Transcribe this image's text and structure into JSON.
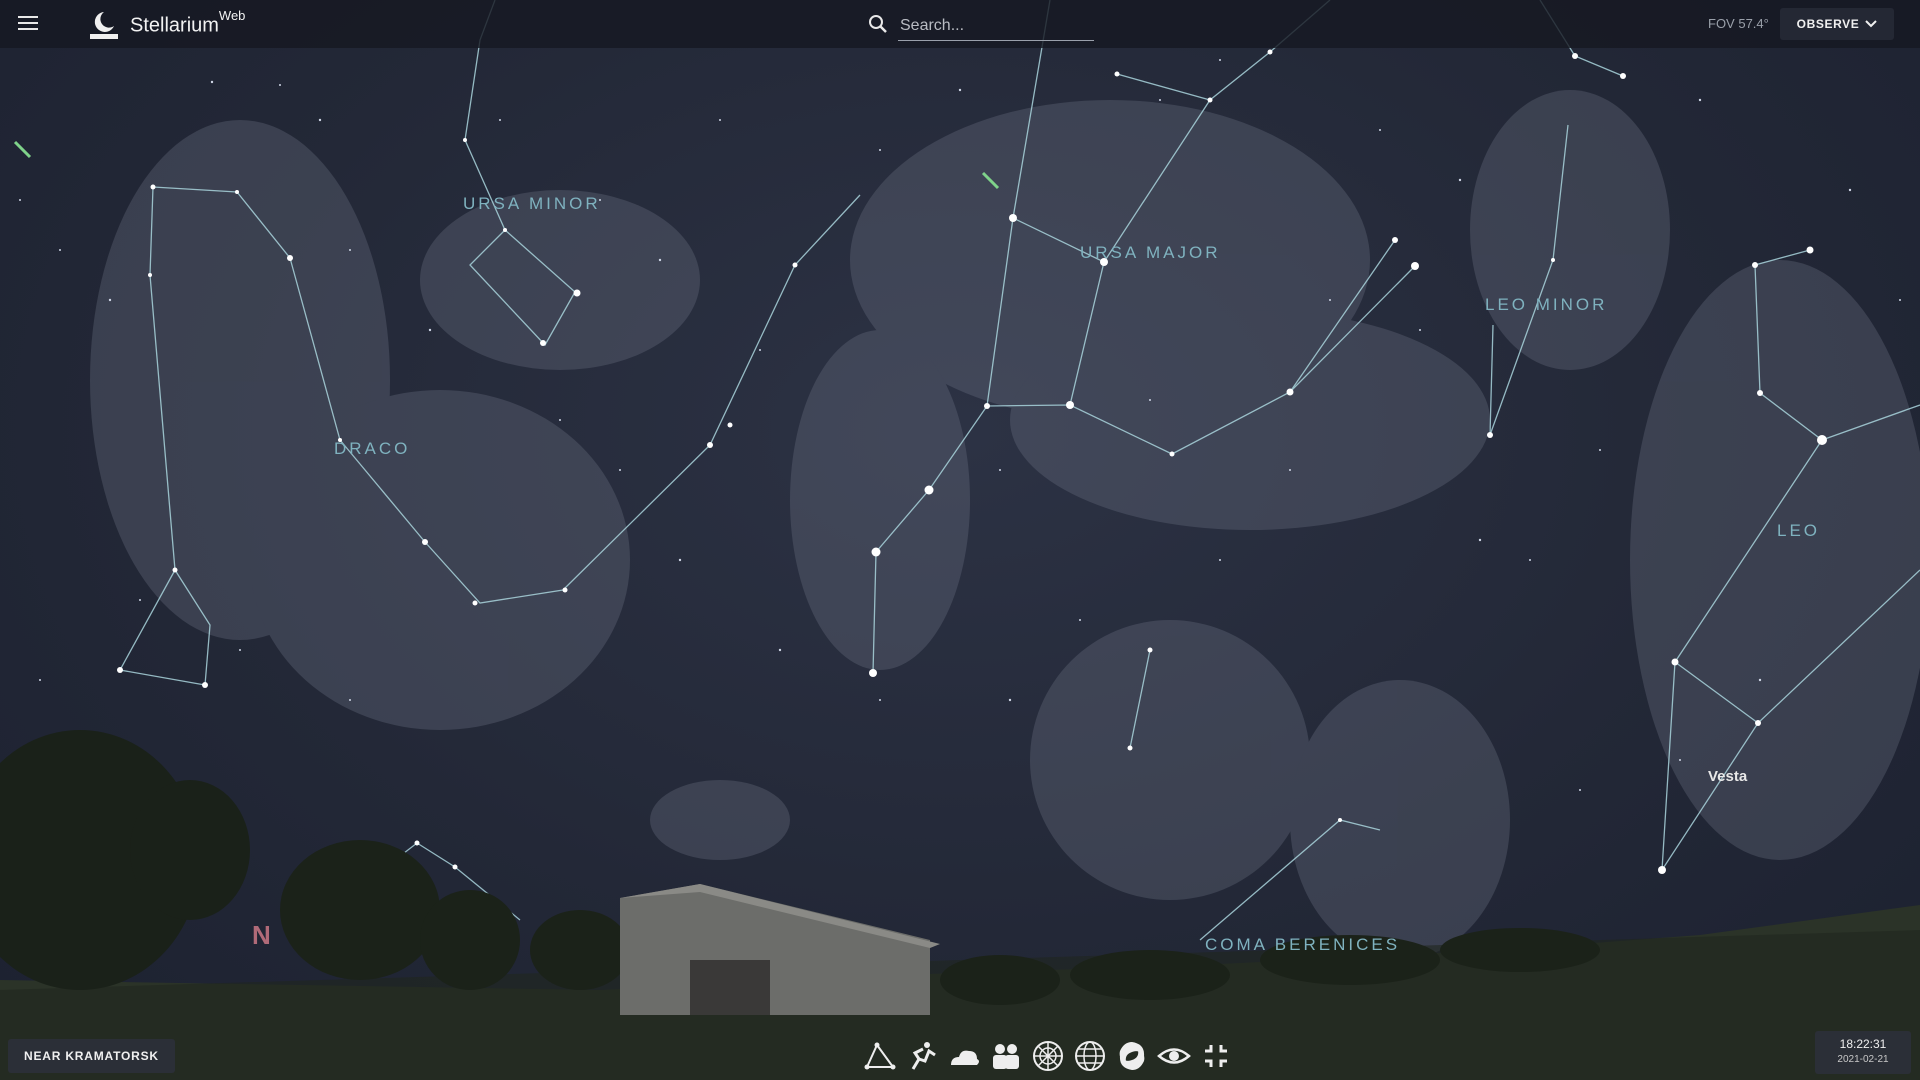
{
  "app": {
    "name": "Stellarium",
    "name_suffix": "Web"
  },
  "header": {
    "search_placeholder": "Search...",
    "fov_label": "FOV 57.4°",
    "observe_label": "OBSERVE"
  },
  "sky": {
    "constellations": [
      {
        "name": "URSA MINOR"
      },
      {
        "name": "URSA MAJOR"
      },
      {
        "name": "LEO MINOR"
      },
      {
        "name": "DRACO"
      },
      {
        "name": "LEO"
      },
      {
        "name": "COMA BERENICES"
      }
    ],
    "planet_label": "Vesta",
    "compass_label": "N"
  },
  "footer": {
    "location_label": "NEAR KRAMATORSK",
    "time": "18:22:31",
    "date": "2021-02-21",
    "tools": [
      {
        "icon": "constellation-lines-icon"
      },
      {
        "icon": "constellation-art-icon"
      },
      {
        "icon": "atmosphere-icon"
      },
      {
        "icon": "landscape-icon"
      },
      {
        "icon": "azimuthal-grid-icon"
      },
      {
        "icon": "equatorial-grid-icon"
      },
      {
        "icon": "deep-sky-objects-icon"
      },
      {
        "icon": "night-mode-icon"
      },
      {
        "icon": "fullscreen-exit-icon"
      }
    ]
  },
  "colors": {
    "sky": "#232837",
    "constellation_line": "#a9d4dc",
    "constellation_label": "#7fb2bf",
    "ground": "#2b3328"
  }
}
